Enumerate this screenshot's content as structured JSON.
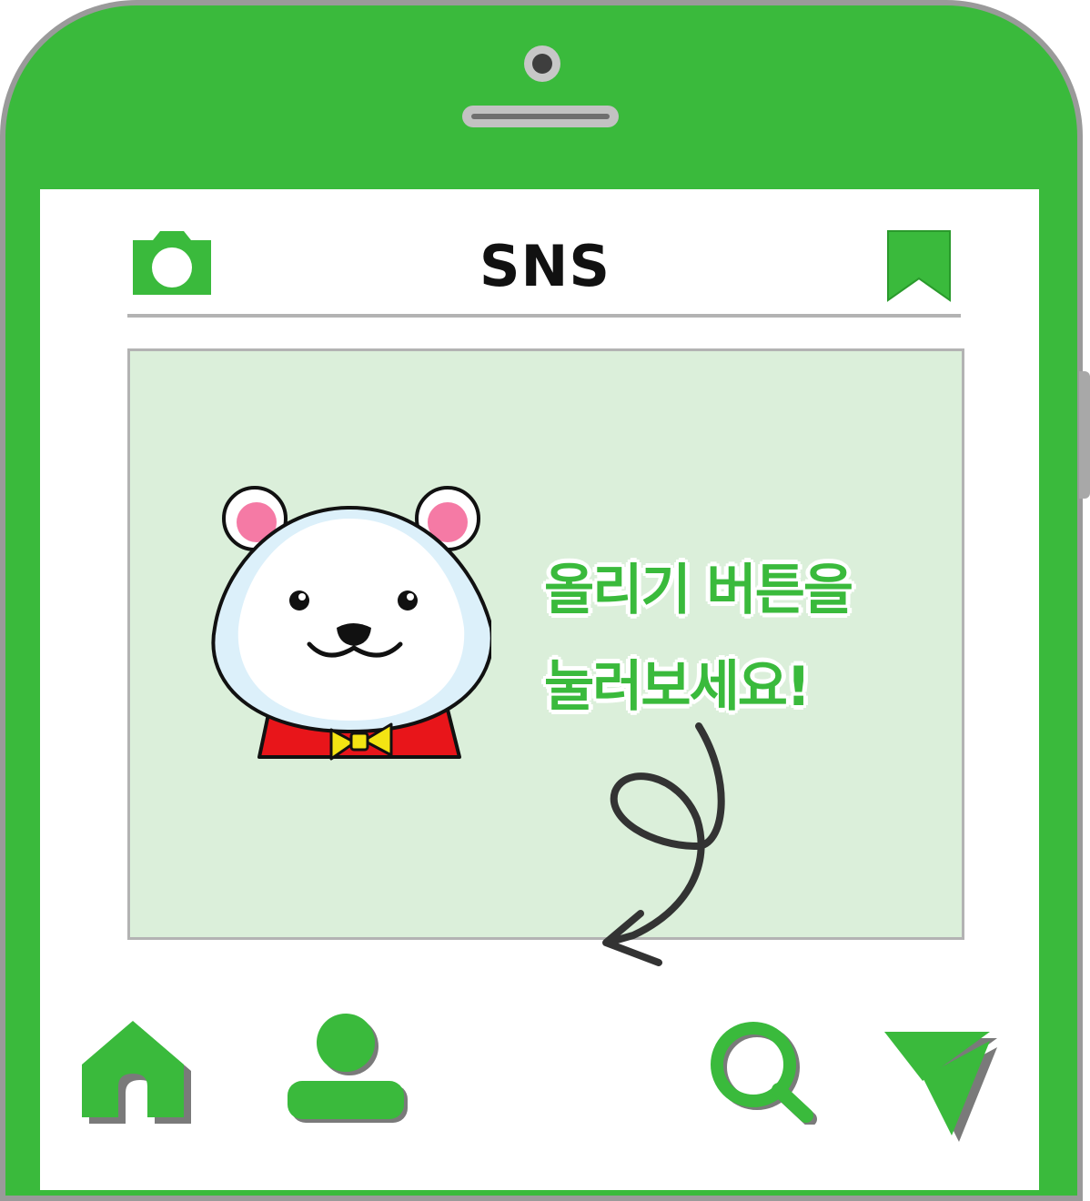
{
  "app": {
    "title": "SNS"
  },
  "header": {
    "camera_icon": "camera-icon",
    "bookmark_icon": "bookmark-icon"
  },
  "post": {
    "message_line1": "올리기 버튼을",
    "message_line2": "눌러보세요!",
    "character": "bear-character"
  },
  "bottom_nav": {
    "items": [
      {
        "icon": "home-icon"
      },
      {
        "icon": "profile-icon"
      },
      {
        "icon": "search-icon"
      },
      {
        "icon": "send-icon"
      }
    ]
  },
  "colors": {
    "brand": "#3aba3c",
    "frame_border": "#9a9a9a",
    "post_background": "#dbefda",
    "divider": "#b3b3b3"
  }
}
